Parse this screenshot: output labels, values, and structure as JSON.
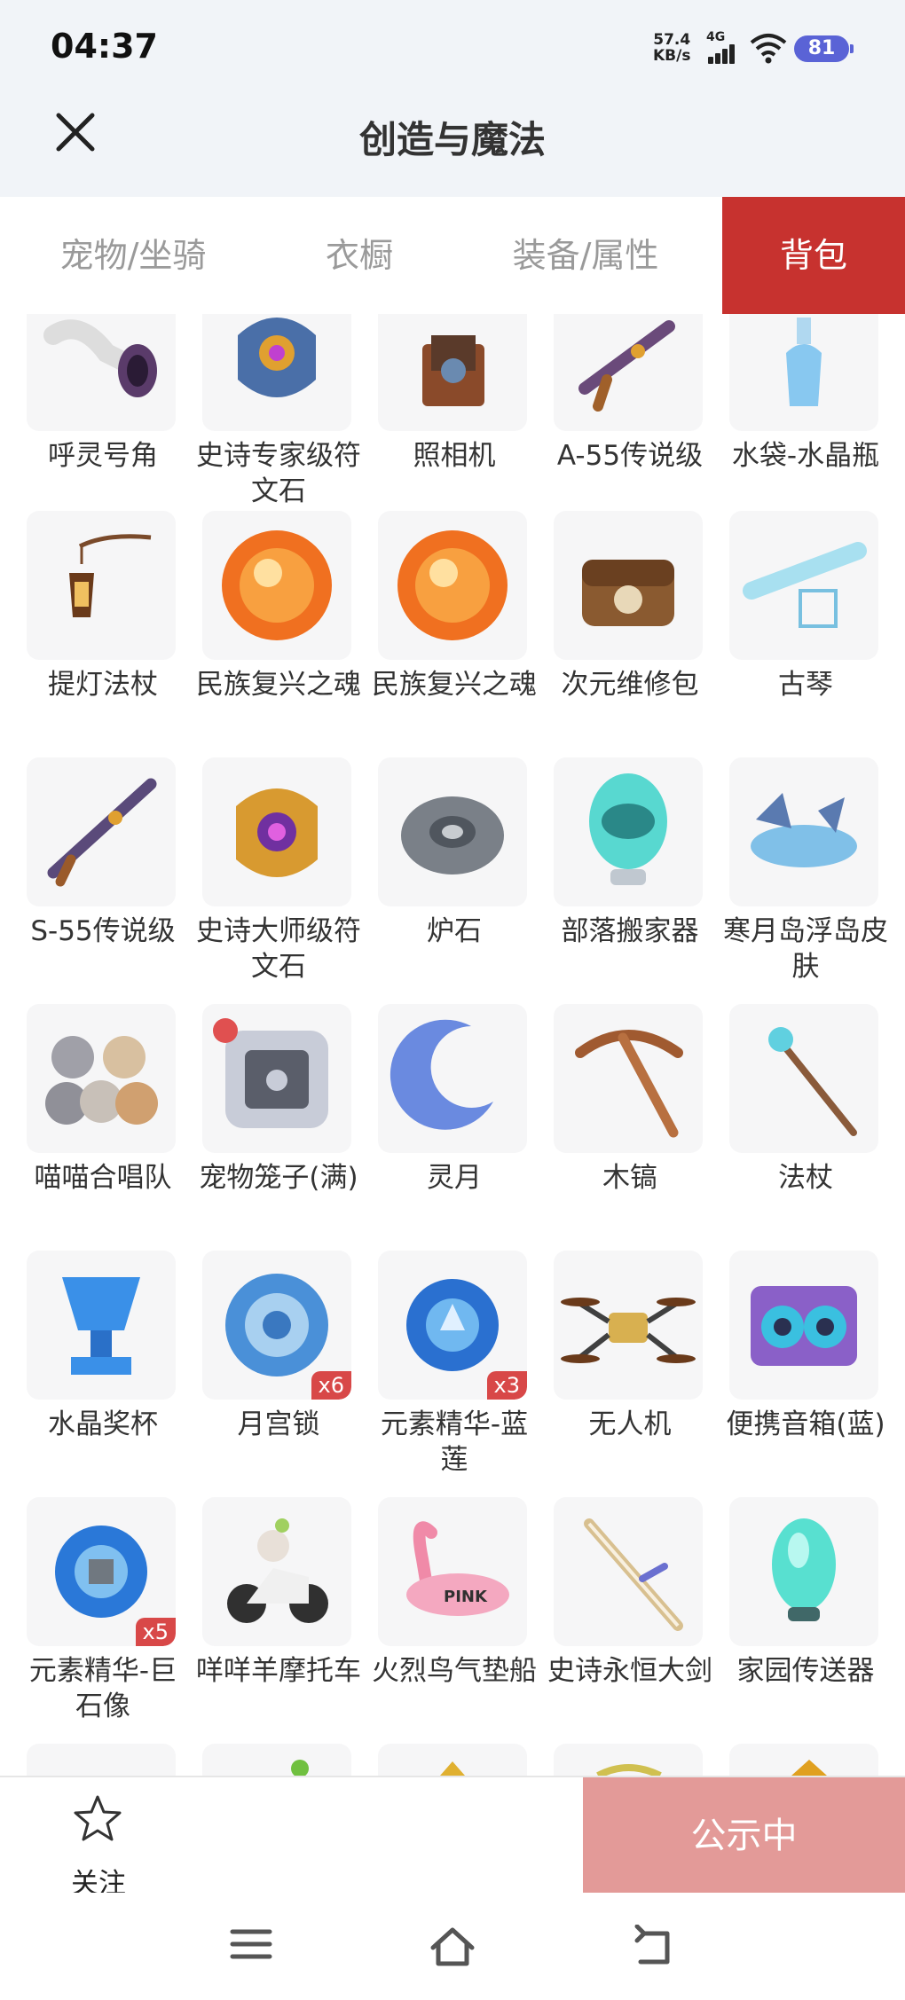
{
  "status": {
    "time": "04:37",
    "net_speed_top": "57.4",
    "net_speed_bottom": "KB/s",
    "signal": "4G",
    "battery": "81"
  },
  "header": {
    "title": "创造与魔法",
    "close_icon": "close-icon"
  },
  "tabs": [
    {
      "label": "宠物/坐骑",
      "active": false
    },
    {
      "label": "衣橱",
      "active": false
    },
    {
      "label": "装备/属性",
      "active": false
    },
    {
      "label": "背包",
      "active": true
    }
  ],
  "items": [
    {
      "name": "呼灵号角",
      "qty": ""
    },
    {
      "name": "史诗专家级符文石",
      "qty": ""
    },
    {
      "name": "照相机",
      "qty": ""
    },
    {
      "name": "A-55传说级",
      "qty": ""
    },
    {
      "name": "水袋-水晶瓶",
      "qty": ""
    },
    {
      "name": "提灯法杖",
      "qty": ""
    },
    {
      "name": "民族复兴之魂",
      "qty": ""
    },
    {
      "name": "民族复兴之魂",
      "qty": ""
    },
    {
      "name": "次元维修包",
      "qty": ""
    },
    {
      "name": "古琴",
      "qty": ""
    },
    {
      "name": "S-55传说级",
      "qty": ""
    },
    {
      "name": "史诗大师级符文石",
      "qty": ""
    },
    {
      "name": "炉石",
      "qty": ""
    },
    {
      "name": "部落搬家器",
      "qty": ""
    },
    {
      "name": "寒月岛浮岛皮肤",
      "qty": ""
    },
    {
      "name": "喵喵合唱队",
      "qty": ""
    },
    {
      "name": "宠物笼子(满)",
      "qty": ""
    },
    {
      "name": "灵月",
      "qty": ""
    },
    {
      "name": "木镐",
      "qty": ""
    },
    {
      "name": "法杖",
      "qty": ""
    },
    {
      "name": "水晶奖杯",
      "qty": ""
    },
    {
      "name": "月宫锁",
      "qty": "x6"
    },
    {
      "name": "元素精华-蓝莲",
      "qty": "x3"
    },
    {
      "name": "无人机",
      "qty": ""
    },
    {
      "name": "便携音箱(蓝)",
      "qty": ""
    },
    {
      "name": "元素精华-巨石像",
      "qty": "x5"
    },
    {
      "name": "咩咩羊摩托车",
      "qty": ""
    },
    {
      "name": "火烈鸟气垫船",
      "qty": ""
    },
    {
      "name": "史诗永恒大剑",
      "qty": ""
    },
    {
      "name": "家园传送器",
      "qty": ""
    }
  ],
  "bottom": {
    "follow_label": "关注",
    "public_label": "公示中"
  },
  "colors": {
    "accent": "#c7322f",
    "public_button": "#e39a98",
    "battery": "#5a63d6"
  }
}
